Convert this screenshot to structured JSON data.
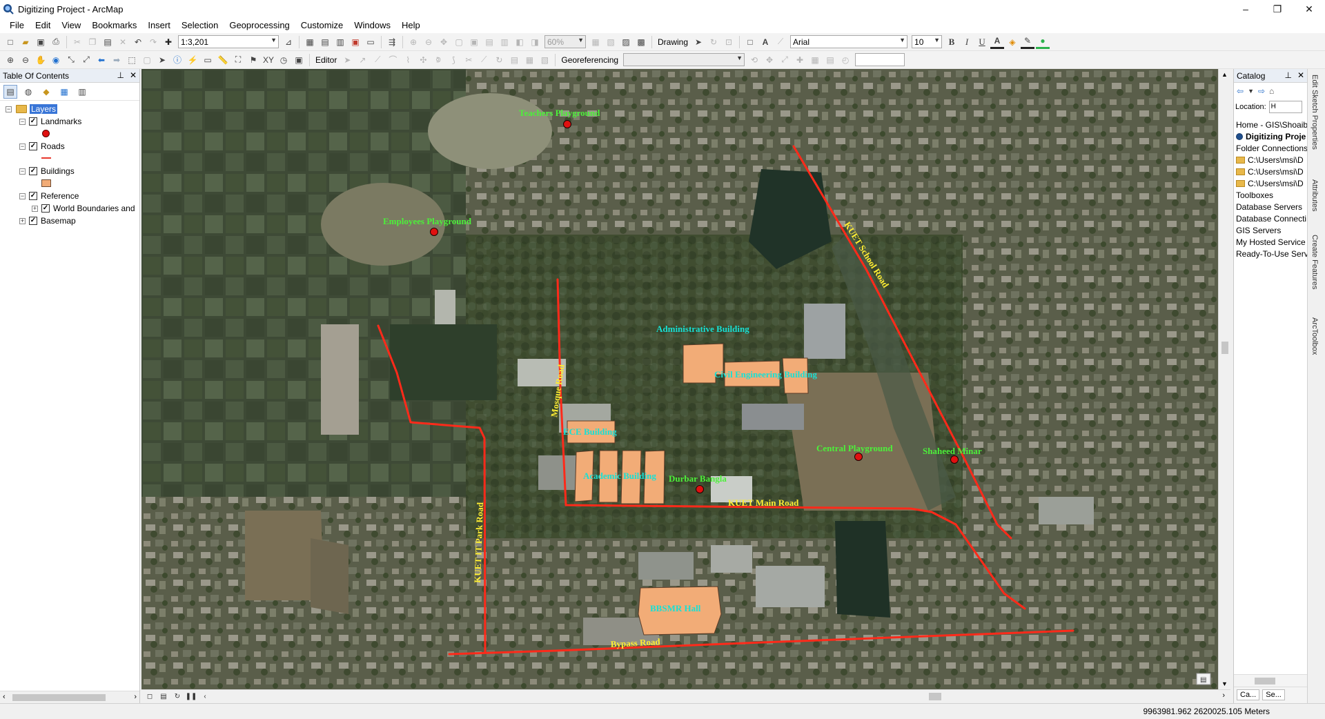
{
  "window": {
    "title": "Digitizing Project - ArcMap",
    "minimize": "–",
    "maximize": "❐",
    "close": "✕"
  },
  "menu": [
    "File",
    "Edit",
    "View",
    "Bookmarks",
    "Insert",
    "Selection",
    "Geoprocessing",
    "Customize",
    "Windows",
    "Help"
  ],
  "toolbar": {
    "scale": "1:3,201",
    "zoom_percent": "60%",
    "drawing_label": "Drawing",
    "font_name": "Arial",
    "font_size": "10",
    "bold": "B",
    "italic": "I",
    "underline": "U",
    "editor_label": "Editor",
    "georef_label": "Georeferencing"
  },
  "toc": {
    "title": "Table Of Contents",
    "root": "Layers",
    "layers": [
      {
        "name": "Landmarks",
        "checked": true,
        "symbol": "point"
      },
      {
        "name": "Roads",
        "checked": true,
        "symbol": "line"
      },
      {
        "name": "Buildings",
        "checked": true,
        "symbol": "polygon"
      },
      {
        "name": "Reference",
        "checked": true,
        "symbol": "group"
      },
      {
        "name": "World Boundaries and",
        "checked": true,
        "symbol": "sublayer"
      },
      {
        "name": "Basemap",
        "checked": true,
        "symbol": "group"
      }
    ]
  },
  "map": {
    "landmarks": [
      "Teachers Playground",
      "Employees Playground",
      "Central Playground",
      "Shaheed Minar",
      "Durbar Bangla"
    ],
    "buildings": [
      "Administrative Building",
      "Civil Engineering Building",
      "ECE Building",
      "Academic Building",
      "BBSMR Hall"
    ],
    "roads": [
      "KUET School Road",
      "Mosque Road",
      "KUET Main Road",
      "KUET IT Park Road",
      "Bypass Road"
    ]
  },
  "catalog": {
    "title": "Catalog",
    "location_label": "Location:",
    "location_value": "H",
    "items": [
      "Home - GIS\\Shoaib",
      "Digitizing Proje",
      "Folder Connections",
      "C:\\Users\\msi\\D",
      "C:\\Users\\msi\\D",
      "C:\\Users\\msi\\D",
      "Toolboxes",
      "Database Servers",
      "Database Connecti",
      "GIS Servers",
      "My Hosted Service",
      "Ready-To-Use Serv"
    ],
    "tabs": [
      "Ca...",
      "Se..."
    ]
  },
  "side_tabs": [
    "Edit Sketch Properties",
    "Attributes",
    "Create Features",
    "ArcToolbox"
  ],
  "status": {
    "coordinates": "9963981.962  2620025.105 Meters"
  },
  "colors": {
    "road": "#ff2a1a",
    "building_fill": "#f2ac77",
    "landmark": "#e01010",
    "landmark_label": "#4cf03a",
    "building_label": "#18e0d4",
    "road_label": "#ffee33",
    "selection": "#3875d7"
  }
}
